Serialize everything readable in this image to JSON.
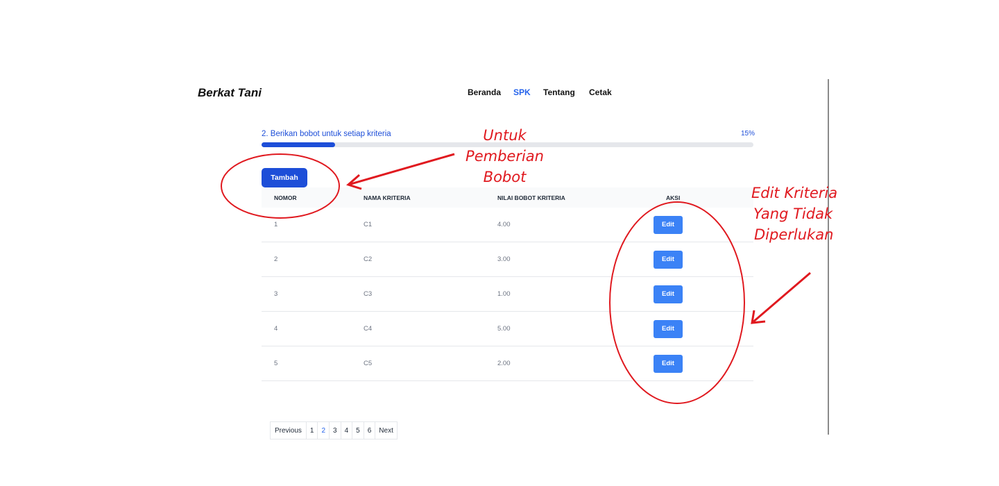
{
  "header": {
    "brand": "Berkat Tani",
    "nav": [
      "Beranda",
      "SPK",
      "Tentang",
      "Cetak"
    ],
    "active_nav": "SPK"
  },
  "step": {
    "label": "2. Berikan bobot untuk setiap kriteria",
    "percent_text": "15%",
    "progress": 0.15
  },
  "actions": {
    "add_label": "Tambah"
  },
  "table": {
    "columns": [
      "NOMOR",
      "NAMA KRITERIA",
      "NILAI BOBOT KRITERIA",
      "AKSI"
    ],
    "rows": [
      {
        "no": "1",
        "name": "C1",
        "weight": "4.00",
        "action": "Edit"
      },
      {
        "no": "2",
        "name": "C2",
        "weight": "3.00",
        "action": "Edit"
      },
      {
        "no": "3",
        "name": "C3",
        "weight": "1.00",
        "action": "Edit"
      },
      {
        "no": "4",
        "name": "C4",
        "weight": "5.00",
        "action": "Edit"
      },
      {
        "no": "5",
        "name": "C5",
        "weight": "2.00",
        "action": "Edit"
      }
    ]
  },
  "pagination": {
    "previous": "Previous",
    "pages": [
      "1",
      "2",
      "3",
      "4",
      "5",
      "6"
    ],
    "current": "2",
    "next": "Next"
  },
  "annotations": {
    "left": [
      "Untuk",
      "Pemberian",
      "Bobot"
    ],
    "right": [
      "Edit Kriteria",
      "Yang Tidak",
      "Diperlukan"
    ]
  },
  "colors": {
    "primary": "#1d4ed8",
    "edit_button": "#3b82f6",
    "annotation": "#e0191f"
  }
}
